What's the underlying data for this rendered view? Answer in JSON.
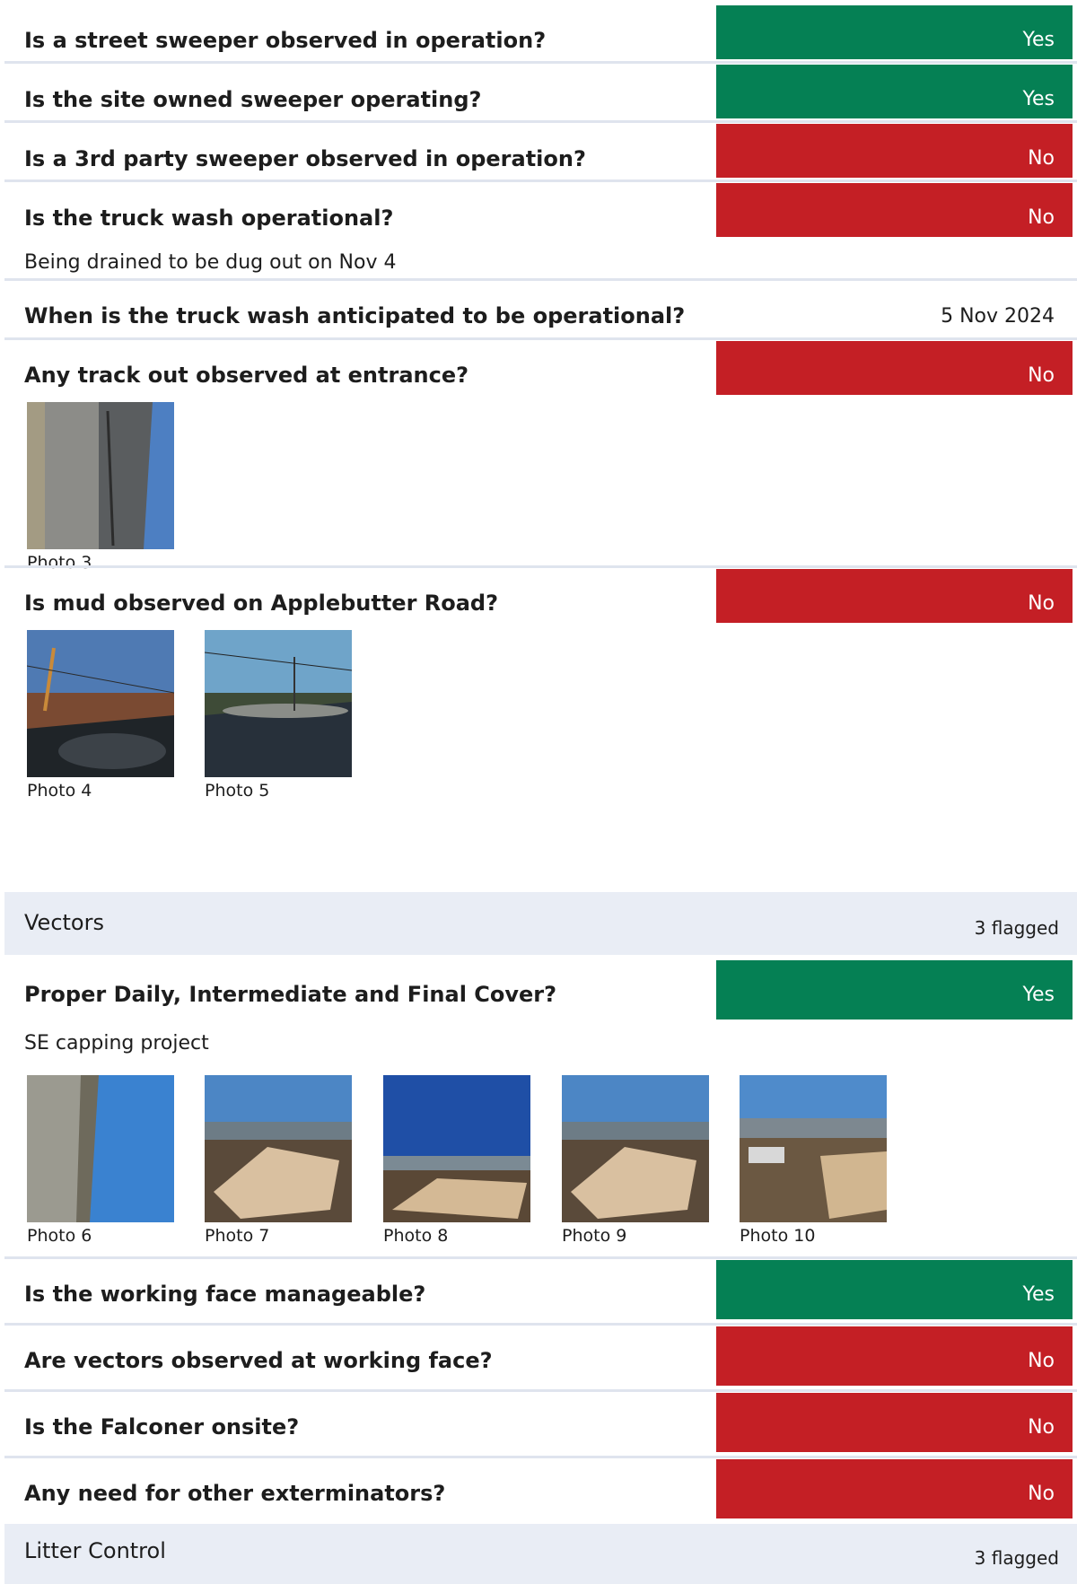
{
  "questions": [
    {
      "question": "Is a street sweeper observed in operation?",
      "answer": "Yes"
    },
    {
      "question": "Is the site owned sweeper operating?",
      "answer": "Yes"
    },
    {
      "question": "Is a 3rd party sweeper observed in operation?",
      "answer": "No"
    },
    {
      "question": "Is the truck wash operational?",
      "answer": "No",
      "note": "Being drained to be dug out on Nov 4"
    },
    {
      "question": "When is the truck wash anticipated to be operational?",
      "answer": "5 Nov 2024"
    },
    {
      "question": "Any track out observed at entrance?",
      "answer": "No",
      "photos": [
        "Photo 3"
      ]
    },
    {
      "question": "Is mud observed on Applebutter Road?",
      "answer": "No",
      "photos": [
        "Photo 4",
        "Photo 5"
      ]
    }
  ],
  "sections": [
    {
      "title": "Vectors",
      "count": "3 flagged"
    },
    {
      "title": "Litter Control",
      "count": "3 flagged"
    }
  ],
  "vectors_questions": [
    {
      "question": "Proper Daily, Intermediate and Final Cover?",
      "answer": "Yes",
      "note": "SE capping project",
      "photos": [
        "Photo 6",
        "Photo 7",
        "Photo 8",
        "Photo 9",
        "Photo 10"
      ]
    },
    {
      "question": "Is the working face manageable?",
      "answer": "Yes"
    },
    {
      "question": "Are vectors observed at working face?",
      "answer": "No"
    },
    {
      "question": "Is the Falconer onsite?",
      "answer": "No"
    },
    {
      "question": "Any need for other exterminators?",
      "answer": "No"
    }
  ],
  "colors": {
    "yes": "#058054",
    "no": "#c41f25",
    "section_bg": "#e9edf5",
    "separator": "#dfe4ee"
  },
  "photo_subjects": {
    "Photo 3": "rotated roadside with grass and sky",
    "Photo 4": "utility pole and trees seen from dashboard",
    "Photo 5": "power lines and road seen from dashboard",
    "Photo 6": "rotated gravel surface and sky",
    "Photo 7": "landfill cap with valley view",
    "Photo 8": "landfill cap under deep blue sky",
    "Photo 9": "landfill cap with valley view",
    "Photo 10": "landfill road with equipment"
  }
}
